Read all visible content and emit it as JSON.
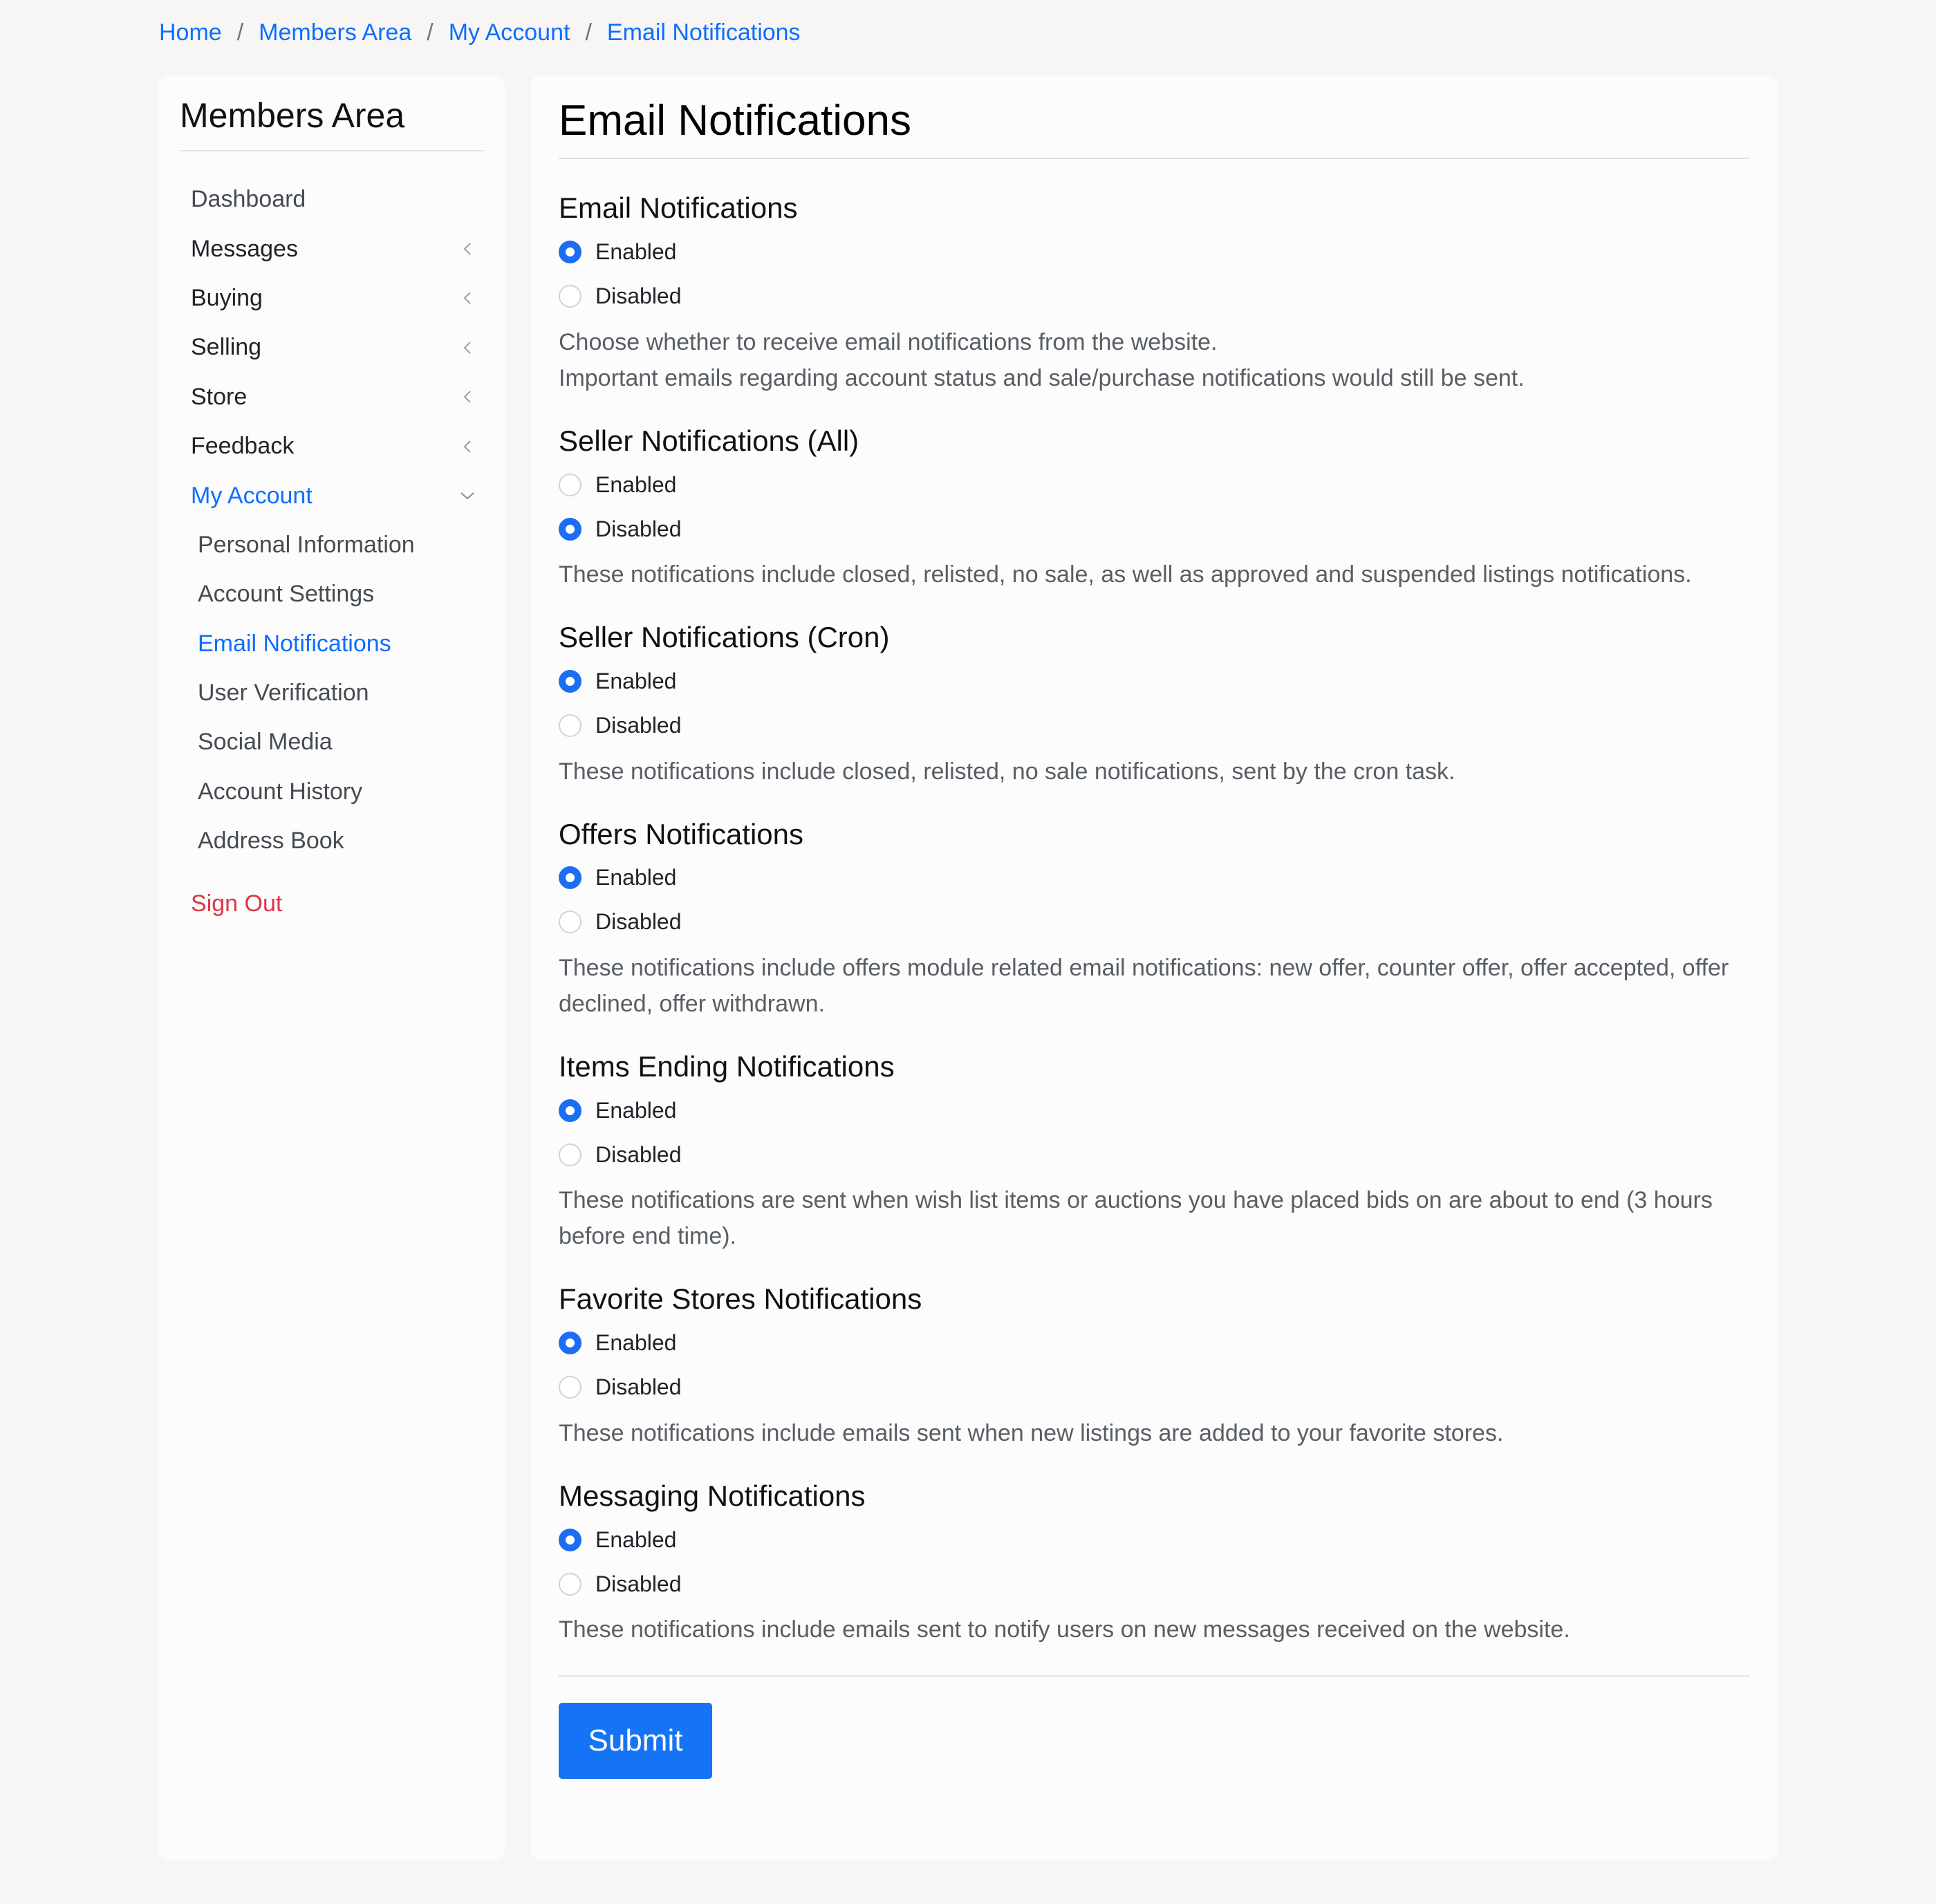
{
  "breadcrumb": [
    "Home",
    "Members Area",
    "My Account",
    "Email Notifications"
  ],
  "breadcrumb_separator": "/",
  "sidebar": {
    "title": "Members Area",
    "items": [
      {
        "label": "Dashboard",
        "icon": "",
        "state": "muted"
      },
      {
        "label": "Messages",
        "icon": "chevron-left-icon",
        "state": ""
      },
      {
        "label": "Buying",
        "icon": "chevron-left-icon",
        "state": ""
      },
      {
        "label": "Selling",
        "icon": "chevron-left-icon",
        "state": ""
      },
      {
        "label": "Store",
        "icon": "chevron-left-icon",
        "state": ""
      },
      {
        "label": "Feedback",
        "icon": "chevron-left-icon",
        "state": ""
      },
      {
        "label": "My Account",
        "icon": "chevron-down-icon",
        "state": "active"
      }
    ],
    "subitems": [
      {
        "label": "Personal Information",
        "active": false
      },
      {
        "label": "Account Settings",
        "active": false
      },
      {
        "label": "Email Notifications",
        "active": true
      },
      {
        "label": "User Verification",
        "active": false
      },
      {
        "label": "Social Media",
        "active": false
      },
      {
        "label": "Account History",
        "active": false
      },
      {
        "label": "Address Book",
        "active": false
      }
    ],
    "signout": "Sign Out"
  },
  "main": {
    "title": "Email Notifications",
    "options": [
      "Enabled",
      "Disabled"
    ],
    "sections": [
      {
        "title": "Email Notifications",
        "selected": "Enabled",
        "description": [
          "Choose whether to receive email notifications from the website.",
          "Important emails regarding account status and sale/purchase notifications would still be sent."
        ]
      },
      {
        "title": "Seller Notifications (All)",
        "selected": "Disabled",
        "description": [
          "These notifications include closed, relisted, no sale, as well as approved and suspended listings notifications."
        ]
      },
      {
        "title": "Seller Notifications (Cron)",
        "selected": "Enabled",
        "description": [
          "These notifications include closed, relisted, no sale notifications, sent by the cron task."
        ]
      },
      {
        "title": "Offers Notifications",
        "selected": "Enabled",
        "description": [
          "These notifications include offers module related email notifications: new offer, counter offer, offer accepted, offer declined, offer withdrawn."
        ]
      },
      {
        "title": "Items Ending Notifications",
        "selected": "Enabled",
        "description": [
          "These notifications are sent when wish list items or auctions you have placed bids on are about to end (3 hours before end time)."
        ]
      },
      {
        "title": "Favorite Stores Notifications",
        "selected": "Enabled",
        "description": [
          "These notifications include emails sent when new listings are added to your favorite stores."
        ]
      },
      {
        "title": "Messaging Notifications",
        "selected": "Enabled",
        "description": [
          "These notifications include emails sent to notify users on new messages received on the website."
        ]
      }
    ],
    "submit_label": "Submit"
  },
  "colors": {
    "accent": "#0d6efd",
    "signout": "#dc3545",
    "button": "#1574f6",
    "background": "#f7f6f5"
  }
}
